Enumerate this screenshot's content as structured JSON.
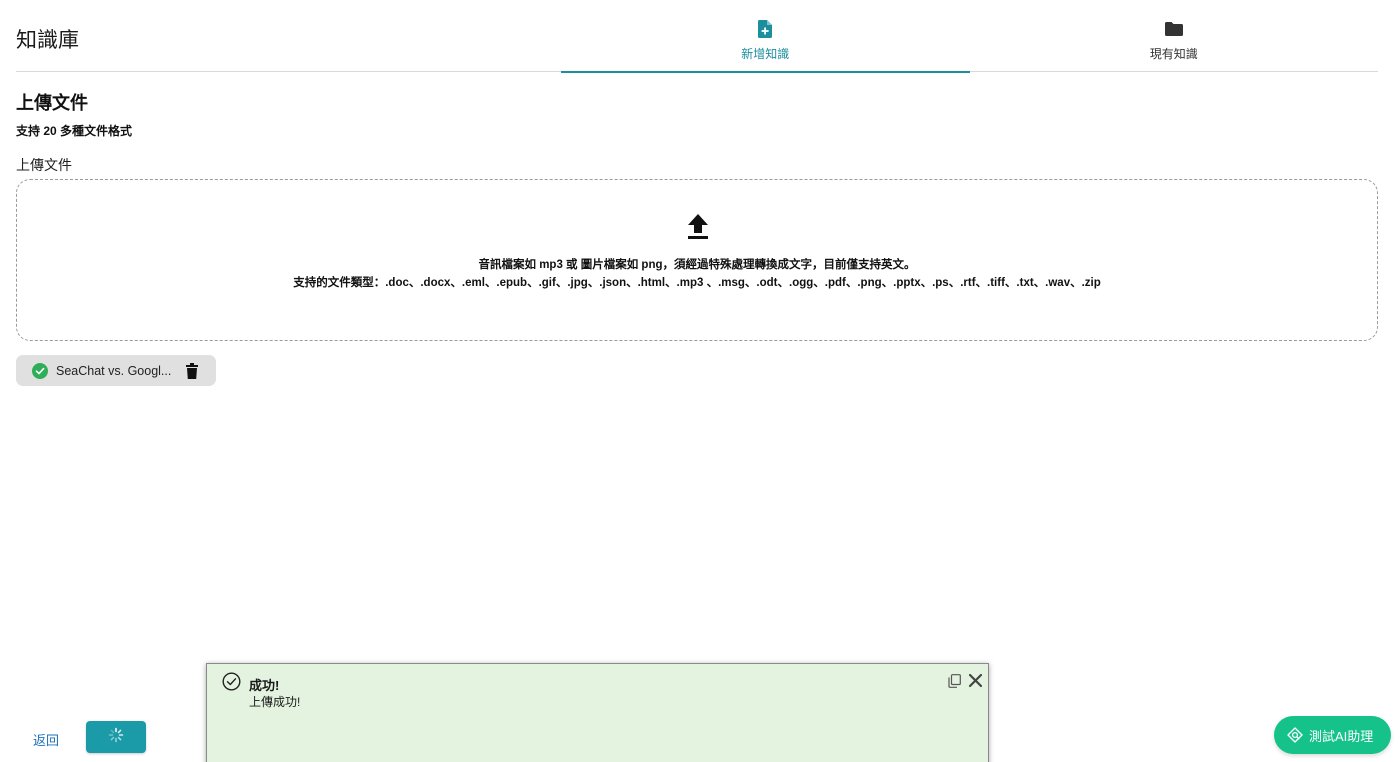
{
  "header": {
    "title": "知識庫",
    "tabs": [
      {
        "label": "新增知識",
        "icon": "file-add-icon",
        "active": true
      },
      {
        "label": "現有知識",
        "icon": "folder-icon",
        "active": false
      }
    ]
  },
  "upload": {
    "section_title": "上傳文件",
    "subtitle": "支持 20 多種文件格式",
    "field_label": "上傳文件",
    "dropzone": {
      "icon": "upload-icon",
      "line1": "音訊檔案如 mp3 或 圖片檔案如 png，須經過特殊處理轉換成文字，目前僅支持英文。",
      "line2": "支持的文件類型：.doc、.docx、.eml、.epub、.gif、.jpg、.json、.html、.mp3 、.msg、.odt、.ogg、.pdf、.png、.pptx、.ps、.rtf、.tiff、.txt、.wav、.zip"
    },
    "files": [
      {
        "name": "SeaChat vs. Googl...",
        "status": "success"
      }
    ]
  },
  "footer": {
    "back_label": "返回",
    "submit_state": "loading"
  },
  "toast": {
    "title": "成功!",
    "message": "上傳成功!",
    "status": "success"
  },
  "ai_button": {
    "label": "測試AI助理"
  },
  "colors": {
    "accent": "#1d8e9e",
    "submit": "#1b9aa8",
    "success": "#2fae5a",
    "ai_button": "#14c28a",
    "toast_bg": "#e4f3e0"
  }
}
